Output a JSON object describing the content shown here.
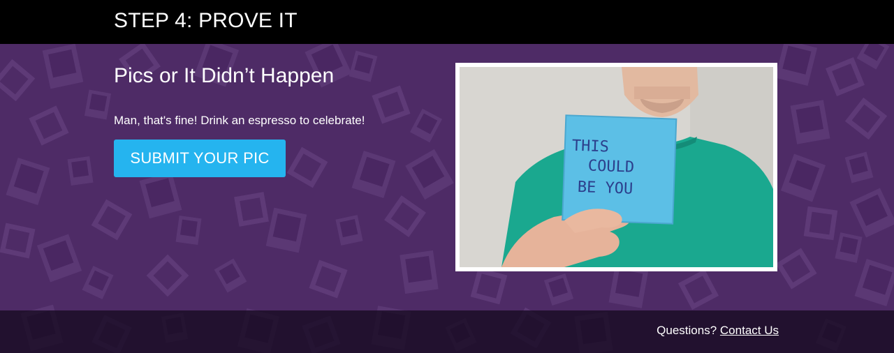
{
  "header": {
    "title": "STEP 4: PROVE IT"
  },
  "main": {
    "headline": "Pics or It Didn’t Happen",
    "message": "Man, that's fine! Drink an espresso to celebrate!",
    "submit_label": "SUBMIT YOUR PIC"
  },
  "photo": {
    "note_lines": [
      "THIS",
      "COULD",
      "BE YOU"
    ]
  },
  "footer": {
    "questions_label": "Questions?",
    "contact_label": "Contact Us"
  },
  "colors": {
    "header_bg": "#000000",
    "body_bg": "#4e2b66",
    "button_bg": "#25b4ef",
    "footer_bg": "#1f1029",
    "text": "#ffffff"
  }
}
